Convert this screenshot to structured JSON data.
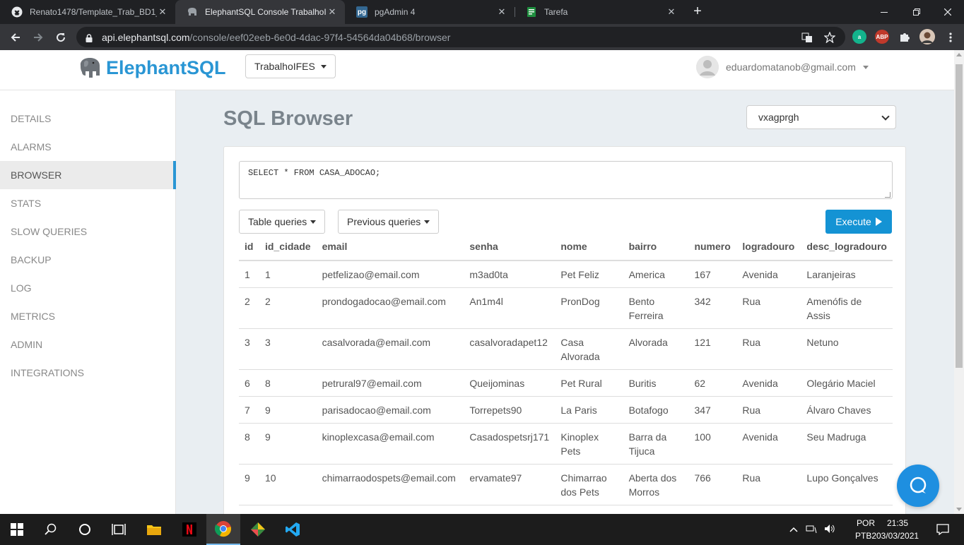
{
  "browser": {
    "tabs": [
      {
        "title": "Renato1478/Template_Trab_BD1_",
        "icon": "github-icon",
        "close": "✕"
      },
      {
        "title": "ElephantSQL Console TrabalhoIFES",
        "icon": "elephant-icon",
        "close": "✕"
      },
      {
        "title": "pgAdmin 4",
        "icon": "pgadmin-icon",
        "close": "✕"
      },
      {
        "title": "Tarefa",
        "icon": "classroom-icon",
        "close": "✕"
      }
    ],
    "url_host": "api.elephantsql.com",
    "url_path": "/console/eef02eeb-6e0d-4dac-97f4-54564da04b68/browser",
    "ext_abp": "ABP"
  },
  "header": {
    "brand": "ElephantSQL",
    "instance": "TrabalhoIFES",
    "user_email": "eduardomatanob@gmail.com"
  },
  "sidebar": {
    "items": [
      {
        "label": "DETAILS"
      },
      {
        "label": "ALARMS"
      },
      {
        "label": "BROWSER"
      },
      {
        "label": "STATS"
      },
      {
        "label": "SLOW QUERIES"
      },
      {
        "label": "BACKUP"
      },
      {
        "label": "LOG"
      },
      {
        "label": "METRICS"
      },
      {
        "label": "ADMIN"
      },
      {
        "label": "INTEGRATIONS"
      }
    ]
  },
  "main": {
    "title": "SQL Browser",
    "database": "vxagprgh",
    "query": "SELECT * FROM CASA_ADOCAO;",
    "table_queries_label": "Table queries",
    "previous_queries_label": "Previous queries",
    "execute_label": "Execute"
  },
  "results": {
    "columns": [
      "id",
      "id_cidade",
      "email",
      "senha",
      "nome",
      "bairro",
      "numero",
      "logradouro",
      "desc_logradouro"
    ],
    "rows": [
      [
        "1",
        "1",
        "petfelizao@email.com",
        "m3ad0ta",
        "Pet Feliz",
        "America",
        "167",
        "Avenida",
        "Laranjeiras"
      ],
      [
        "2",
        "2",
        "prondogadocao@email.com",
        "An1m4l",
        "PronDog",
        "Bento Ferreira",
        "342",
        "Rua",
        "Amenófis de Assis"
      ],
      [
        "3",
        "3",
        "casalvorada@email.com",
        "casalvoradapet12",
        "Casa Alvorada",
        "Alvorada",
        "121",
        "Rua",
        "Netuno"
      ],
      [
        "6",
        "8",
        "petrural97@email.com",
        "Queijominas",
        "Pet Rural",
        "Buritis",
        "62",
        "Avenida",
        "Olegário Maciel"
      ],
      [
        "7",
        "9",
        "parisadocao@email.com",
        "Torrepets90",
        "La Paris",
        "Botafogo",
        "347",
        "Rua",
        "Álvaro Chaves"
      ],
      [
        "8",
        "9",
        "kinoplexcasa@email.com",
        "Casadospetsrj171",
        "Kinoplex Pets",
        "Barra da Tijuca",
        "100",
        "Avenida",
        "Seu Madruga"
      ],
      [
        "9",
        "10",
        "chimarraodospets@email.com",
        "ervamate97",
        "Chimarrao dos Pets",
        "Aberta dos Morros",
        "766",
        "Rua",
        "Lupo Gonçalves"
      ]
    ]
  },
  "taskbar": {
    "lang": "POR",
    "layout": "PTB2",
    "time": "21:35",
    "date": "03/03/2021"
  },
  "colors": {
    "brand": "#2a96d4",
    "execute": "#1493d4",
    "chat": "#1e8fe0"
  }
}
